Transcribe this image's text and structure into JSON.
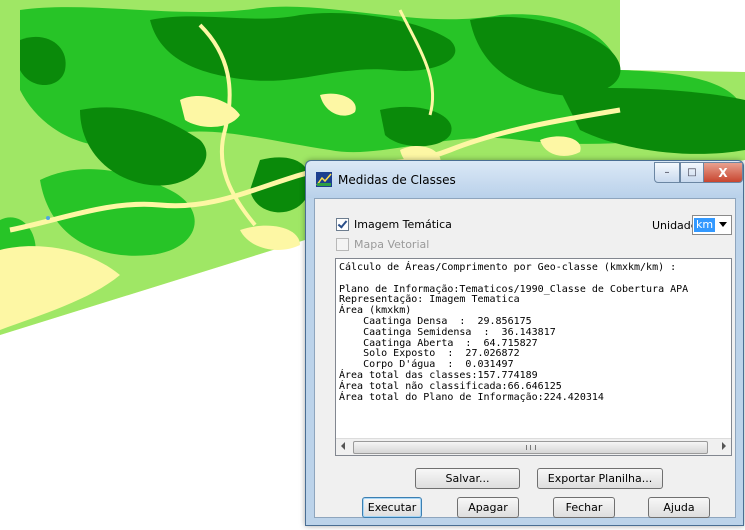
{
  "dialog": {
    "title": "Medidas de Classes",
    "window_buttons": {
      "minimize": "–",
      "maximize": "□",
      "close": "X"
    },
    "imagem_tematica": {
      "label": "Imagem Temática",
      "checked": true
    },
    "mapa_vetorial": {
      "label": "Mapa Vetorial",
      "checked": false,
      "enabled": false
    },
    "unidade": {
      "label": "Unidade:",
      "value": "km"
    },
    "result_lines": [
      "Cálculo de Áreas/Comprimento por Geo-classe (kmxkm/km) :",
      "",
      "Plano de Informação:Tematicos/1990_Classe de Cobertura APA",
      "Representação: Imagem Tematica",
      "Área (kmxkm)",
      "    Caatinga Densa  :  29.856175",
      "    Caatinga Semidensa  :  36.143817",
      "    Caatinga Aberta  :  64.715827",
      "    Solo Exposto  :  27.026872",
      "    Corpo D'água  :  0.031497",
      "Área total das classes:157.774189",
      "Área total não classificada:66.646125",
      "Área total do Plano de Informação:224.420314"
    ],
    "buttons": {
      "salvar": "Salvar...",
      "exportar": "Exportar Planilha...",
      "executar": "Executar",
      "apagar": "Apagar",
      "fechar": "Fechar",
      "ajuda": "Ajuda"
    }
  },
  "map": {
    "colors": {
      "dense": "#0a8a0a",
      "semidense": "#27c427",
      "open": "#8ee45a",
      "soil": "#fdf7a4",
      "water": "#4ea8e0"
    }
  }
}
